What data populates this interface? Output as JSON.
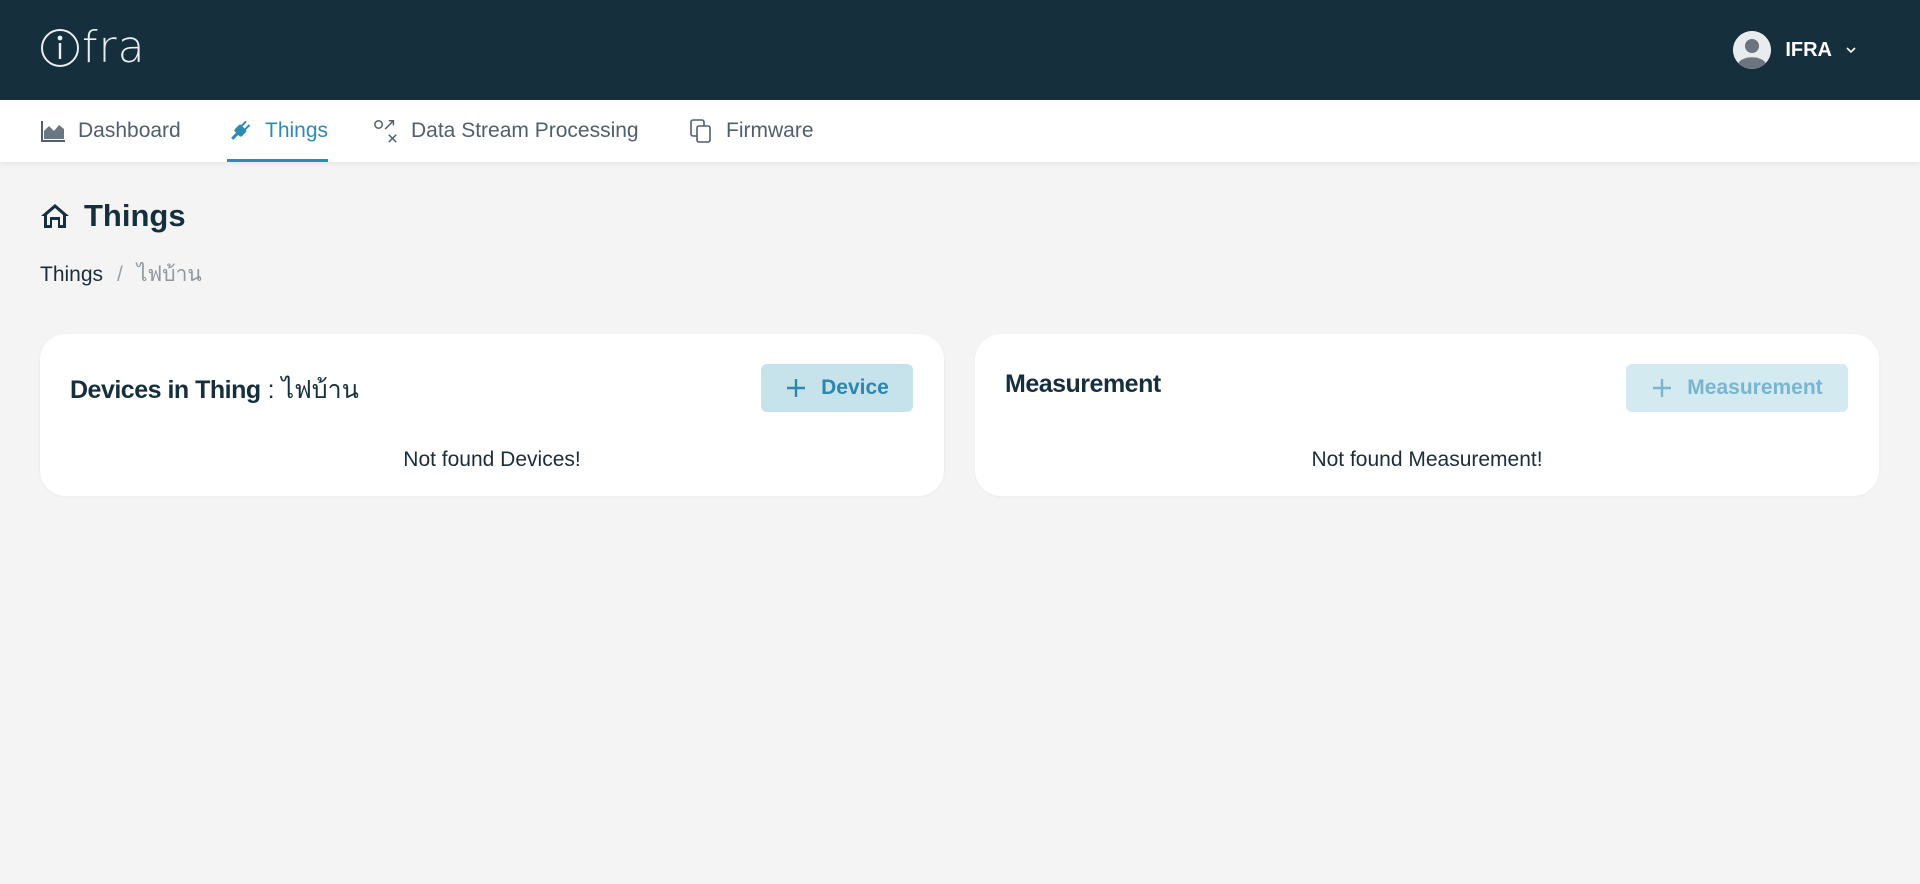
{
  "app": {
    "logo_text": "fra",
    "brand_colors": {
      "header_bg": "#152f3d",
      "accent": "#2f8ab2",
      "page_bg": "#f4f4f4"
    }
  },
  "user": {
    "name": "IFRA",
    "icons": [
      "avatar-icon",
      "chevron-down-icon"
    ]
  },
  "nav": {
    "items": [
      {
        "label": "Dashboard",
        "icon": "area-chart-icon"
      },
      {
        "label": "Things",
        "icon": "plug-icon",
        "active": true
      },
      {
        "label": "Data Stream Processing",
        "icon": "transform-icon"
      },
      {
        "label": "Firmware",
        "icon": "copy-icon"
      }
    ]
  },
  "page": {
    "title": "Things",
    "icon": "home-icon",
    "breadcrumb": {
      "parent": "Things",
      "separator": "/",
      "current": "ไฟบ้าน"
    }
  },
  "devices_card": {
    "title": "Devices in Thing",
    "separator": " : ",
    "thing_name": "ไฟบ้าน",
    "add_button": "Device",
    "empty_text": "Not found Devices!"
  },
  "measurement_card": {
    "title": "Measurement",
    "add_button": "Measurement",
    "empty_text": "Not found Measurement!"
  }
}
